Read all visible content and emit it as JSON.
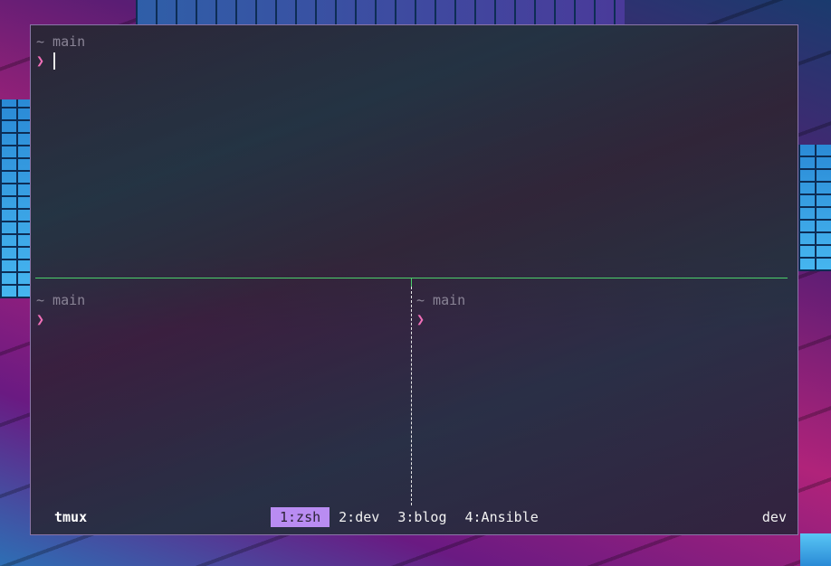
{
  "panes": {
    "top": {
      "dir": "~ main",
      "prompt": "❯"
    },
    "bottom_left": {
      "dir": "~ main",
      "prompt": "❯"
    },
    "bottom_right": {
      "dir": "~ main",
      "prompt": "❯"
    }
  },
  "statusbar": {
    "session": "tmux",
    "windows": [
      {
        "label": "1:zsh",
        "active": true
      },
      {
        "label": "2:dev",
        "active": false
      },
      {
        "label": "3:blog",
        "active": false
      },
      {
        "label": "4:Ansible",
        "active": false
      }
    ],
    "right": "dev"
  },
  "colors": {
    "pane_border_active": "#4bd06b",
    "prompt": "#f06fb8",
    "active_window_bg": "#b98cf2"
  }
}
